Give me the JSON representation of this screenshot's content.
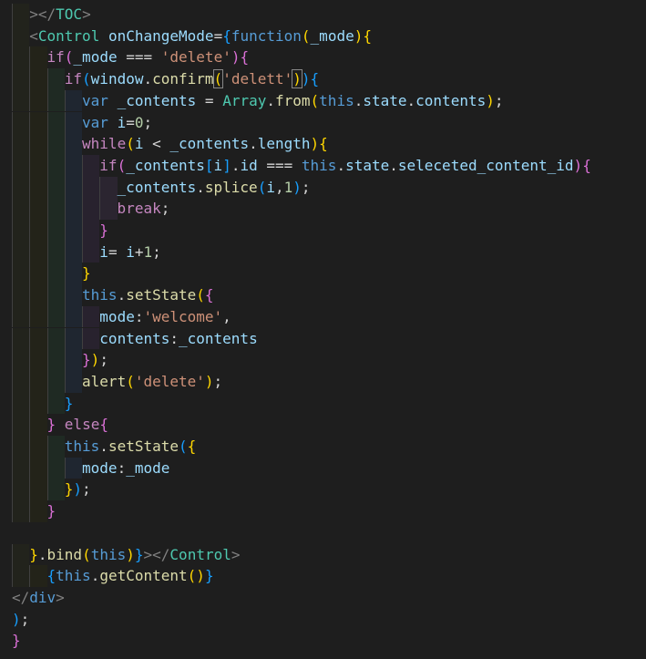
{
  "editor": {
    "lines": [
      [
        {
          "t": "></",
          "c": "c-tag-punct"
        },
        {
          "t": "TOC",
          "c": "c-tag"
        },
        {
          "t": ">",
          "c": "c-tag-punct"
        }
      ],
      [
        {
          "t": "<",
          "c": "c-tag-punct"
        },
        {
          "t": "Control",
          "c": "c-tag"
        },
        {
          "t": " ",
          "c": "c-plain"
        },
        {
          "t": "onChangeMode",
          "c": "c-attr"
        },
        {
          "t": "=",
          "c": "c-op"
        },
        {
          "t": "{",
          "c": "c-brace3"
        },
        {
          "t": "function",
          "c": "c-keyword"
        },
        {
          "t": "(",
          "c": "c-brace1"
        },
        {
          "t": "_mode",
          "c": "c-var"
        },
        {
          "t": ")",
          "c": "c-brace1"
        },
        {
          "t": "{",
          "c": "c-brace1"
        }
      ],
      [
        {
          "t": "if",
          "c": "c-control"
        },
        {
          "t": "(",
          "c": "c-brace2"
        },
        {
          "t": "_mode",
          "c": "c-var"
        },
        {
          "t": " === ",
          "c": "c-op"
        },
        {
          "t": "'delete'",
          "c": "c-str"
        },
        {
          "t": ")",
          "c": "c-brace2"
        },
        {
          "t": "{",
          "c": "c-brace2"
        }
      ],
      [
        {
          "t": "if",
          "c": "c-control"
        },
        {
          "t": "(",
          "c": "c-brace3"
        },
        {
          "t": "window",
          "c": "c-var"
        },
        {
          "t": ".",
          "c": "c-op"
        },
        {
          "t": "confirm",
          "c": "c-func"
        },
        {
          "t": "(",
          "c": "c-brace1",
          "hl": true
        },
        {
          "t": "'delett'",
          "c": "c-str"
        },
        {
          "t": ")",
          "c": "c-brace1",
          "hl": true
        },
        {
          "t": ")",
          "c": "c-brace3"
        },
        {
          "t": "{",
          "c": "c-brace3"
        }
      ],
      [
        {
          "t": "var",
          "c": "c-keyword"
        },
        {
          "t": " ",
          "c": "c-plain"
        },
        {
          "t": "_contents",
          "c": "c-var"
        },
        {
          "t": " = ",
          "c": "c-op"
        },
        {
          "t": "Array",
          "c": "c-class"
        },
        {
          "t": ".",
          "c": "c-op"
        },
        {
          "t": "from",
          "c": "c-func"
        },
        {
          "t": "(",
          "c": "c-brace1"
        },
        {
          "t": "this",
          "c": "c-keyword"
        },
        {
          "t": ".",
          "c": "c-op"
        },
        {
          "t": "state",
          "c": "c-var"
        },
        {
          "t": ".",
          "c": "c-op"
        },
        {
          "t": "contents",
          "c": "c-var"
        },
        {
          "t": ")",
          "c": "c-brace1"
        },
        {
          "t": ";",
          "c": "c-op"
        }
      ],
      [
        {
          "t": "var",
          "c": "c-keyword"
        },
        {
          "t": " ",
          "c": "c-plain"
        },
        {
          "t": "i",
          "c": "c-var"
        },
        {
          "t": "=",
          "c": "c-op"
        },
        {
          "t": "0",
          "c": "c-num"
        },
        {
          "t": ";",
          "c": "c-op"
        }
      ],
      [
        {
          "t": "while",
          "c": "c-control"
        },
        {
          "t": "(",
          "c": "c-brace1"
        },
        {
          "t": "i",
          "c": "c-var"
        },
        {
          "t": " < ",
          "c": "c-op"
        },
        {
          "t": "_contents",
          "c": "c-var"
        },
        {
          "t": ".",
          "c": "c-op"
        },
        {
          "t": "length",
          "c": "c-var"
        },
        {
          "t": ")",
          "c": "c-brace1"
        },
        {
          "t": "{",
          "c": "c-brace1"
        }
      ],
      [
        {
          "t": "if",
          "c": "c-control"
        },
        {
          "t": "(",
          "c": "c-brace2"
        },
        {
          "t": "_contents",
          "c": "c-var"
        },
        {
          "t": "[",
          "c": "c-brace3"
        },
        {
          "t": "i",
          "c": "c-var"
        },
        {
          "t": "]",
          "c": "c-brace3"
        },
        {
          "t": ".",
          "c": "c-op"
        },
        {
          "t": "id",
          "c": "c-var"
        },
        {
          "t": " === ",
          "c": "c-op"
        },
        {
          "t": "this",
          "c": "c-keyword"
        },
        {
          "t": ".",
          "c": "c-op"
        },
        {
          "t": "state",
          "c": "c-var"
        },
        {
          "t": ".",
          "c": "c-op"
        },
        {
          "t": "seleceted_content_id",
          "c": "c-var"
        },
        {
          "t": ")",
          "c": "c-brace2"
        },
        {
          "t": "{",
          "c": "c-brace2"
        }
      ],
      [
        {
          "t": "_contents",
          "c": "c-var"
        },
        {
          "t": ".",
          "c": "c-op"
        },
        {
          "t": "splice",
          "c": "c-func"
        },
        {
          "t": "(",
          "c": "c-brace3"
        },
        {
          "t": "i",
          "c": "c-var"
        },
        {
          "t": ",",
          "c": "c-op"
        },
        {
          "t": "1",
          "c": "c-num"
        },
        {
          "t": ")",
          "c": "c-brace3"
        },
        {
          "t": ";",
          "c": "c-op"
        }
      ],
      [
        {
          "t": "break",
          "c": "c-control"
        },
        {
          "t": ";",
          "c": "c-op"
        }
      ],
      [
        {
          "t": "}",
          "c": "c-brace2"
        }
      ],
      [
        {
          "t": "i",
          "c": "c-var"
        },
        {
          "t": "= ",
          "c": "c-op"
        },
        {
          "t": "i",
          "c": "c-var"
        },
        {
          "t": "+",
          "c": "c-op"
        },
        {
          "t": "1",
          "c": "c-num"
        },
        {
          "t": ";",
          "c": "c-op"
        }
      ],
      [
        {
          "t": "}",
          "c": "c-brace1"
        }
      ],
      [
        {
          "t": "this",
          "c": "c-keyword"
        },
        {
          "t": ".",
          "c": "c-op"
        },
        {
          "t": "setState",
          "c": "c-func"
        },
        {
          "t": "(",
          "c": "c-brace1"
        },
        {
          "t": "{",
          "c": "c-brace2"
        }
      ],
      [
        {
          "t": "mode",
          "c": "c-var"
        },
        {
          "t": ":",
          "c": "c-op"
        },
        {
          "t": "'welcome'",
          "c": "c-str"
        },
        {
          "t": ",",
          "c": "c-op"
        }
      ],
      [
        {
          "t": "contents",
          "c": "c-var"
        },
        {
          "t": ":",
          "c": "c-op"
        },
        {
          "t": "_contents",
          "c": "c-var"
        }
      ],
      [
        {
          "t": "}",
          "c": "c-brace2"
        },
        {
          "t": ")",
          "c": "c-brace1"
        },
        {
          "t": ";",
          "c": "c-op"
        }
      ],
      [
        {
          "t": "alert",
          "c": "c-func"
        },
        {
          "t": "(",
          "c": "c-brace1"
        },
        {
          "t": "'delete'",
          "c": "c-str"
        },
        {
          "t": ")",
          "c": "c-brace1"
        },
        {
          "t": ";",
          "c": "c-op"
        }
      ],
      [
        {
          "t": "}",
          "c": "c-brace3"
        }
      ],
      [
        {
          "t": "}",
          "c": "c-brace2"
        },
        {
          "t": " ",
          "c": "c-plain"
        },
        {
          "t": "else",
          "c": "c-control"
        },
        {
          "t": "{",
          "c": "c-brace2"
        }
      ],
      [
        {
          "t": "this",
          "c": "c-keyword"
        },
        {
          "t": ".",
          "c": "c-op"
        },
        {
          "t": "setState",
          "c": "c-func"
        },
        {
          "t": "(",
          "c": "c-brace3"
        },
        {
          "t": "{",
          "c": "c-brace1"
        }
      ],
      [
        {
          "t": "mode",
          "c": "c-var"
        },
        {
          "t": ":",
          "c": "c-op"
        },
        {
          "t": "_mode",
          "c": "c-var"
        }
      ],
      [
        {
          "t": "}",
          "c": "c-brace1"
        },
        {
          "t": ")",
          "c": "c-brace3"
        },
        {
          "t": ";",
          "c": "c-op"
        }
      ],
      [
        {
          "t": "}",
          "c": "c-brace2"
        }
      ],
      [],
      [
        {
          "t": "}",
          "c": "c-brace1"
        },
        {
          "t": ".",
          "c": "c-op"
        },
        {
          "t": "bind",
          "c": "c-func"
        },
        {
          "t": "(",
          "c": "c-brace1"
        },
        {
          "t": "this",
          "c": "c-keyword"
        },
        {
          "t": ")",
          "c": "c-brace1"
        },
        {
          "t": "}",
          "c": "c-brace3"
        },
        {
          "t": "></",
          "c": "c-tag-punct"
        },
        {
          "t": "Control",
          "c": "c-tag"
        },
        {
          "t": ">",
          "c": "c-tag-punct"
        }
      ],
      [
        {
          "t": "{",
          "c": "c-brace3"
        },
        {
          "t": "this",
          "c": "c-keyword"
        },
        {
          "t": ".",
          "c": "c-op"
        },
        {
          "t": "getContent",
          "c": "c-func"
        },
        {
          "t": "(",
          "c": "c-brace1"
        },
        {
          "t": ")",
          "c": "c-brace1"
        },
        {
          "t": "}",
          "c": "c-brace3"
        }
      ],
      [
        {
          "t": "</",
          "c": "c-tag-punct"
        },
        {
          "t": "div",
          "c": "c-keyword"
        },
        {
          "t": ">",
          "c": "c-tag-punct"
        }
      ],
      [
        {
          "t": ")",
          "c": "c-brace3"
        },
        {
          "t": ";",
          "c": "c-op"
        }
      ],
      [
        {
          "t": "}",
          "c": "c-brace2"
        }
      ]
    ]
  }
}
